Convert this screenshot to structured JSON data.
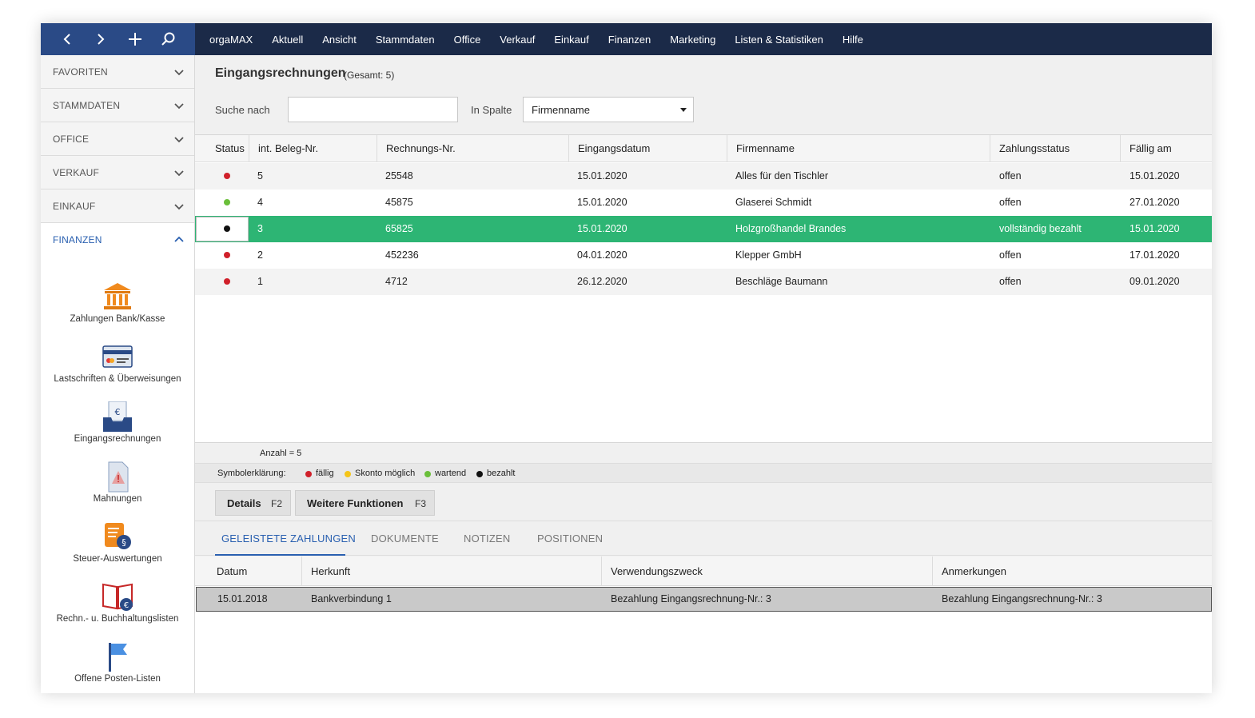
{
  "topbar": {
    "nav": {
      "back_icon": "chevron-left-icon",
      "forward_icon": "chevron-right-icon",
      "new_icon": "plus-icon",
      "search_icon": "search-icon"
    },
    "menu": [
      "orgaMAX",
      "Aktuell",
      "Ansicht",
      "Stammdaten",
      "Office",
      "Verkauf",
      "Einkauf",
      "Finanzen",
      "Marketing",
      "Listen & Statistiken",
      "Hilfe"
    ]
  },
  "sidebar": {
    "sections": [
      "FAVORITEN",
      "STAMMDATEN",
      "OFFICE",
      "VERKAUF",
      "EINKAUF",
      "FINANZEN"
    ],
    "open_section": "FINANZEN",
    "tools": [
      {
        "label": "Zahlungen Bank/Kasse",
        "icon": "bank-icon"
      },
      {
        "label": "Lastschriften & Überweisungen",
        "icon": "card-icon"
      },
      {
        "label": "Eingangsrechnungen",
        "icon": "inbox-euro-icon"
      },
      {
        "label": "Mahnungen",
        "icon": "warning-document-icon"
      },
      {
        "label": "Steuer-Auswertungen",
        "icon": "tax-scroll-icon"
      },
      {
        "label": "Rechn.- u. Buchhaltungslisten",
        "icon": "ledger-book-icon"
      },
      {
        "label": "Offene Posten-Listen",
        "icon": "flag-icon"
      }
    ]
  },
  "main": {
    "title": "Eingangsrechnungen",
    "subtitle": "(Gesamt: 5)",
    "search_label": "Suche nach",
    "search_value": "",
    "column_label": "In Spalte",
    "column_value": "Firmenname"
  },
  "grid": {
    "headers": [
      "Status",
      "int. Beleg-Nr.",
      "Rechnungs-Nr.",
      "Eingangsdatum",
      "Firmenname",
      "Zahlungsstatus",
      "Fällig am"
    ],
    "rows": [
      {
        "status": "fällig",
        "beleg": "5",
        "rechnung": "25548",
        "datum": "15.01.2020",
        "firma": "Alles für den Tischler",
        "zahlung": "offen",
        "faellig": "15.01.2020"
      },
      {
        "status": "wartend",
        "beleg": "4",
        "rechnung": "45875",
        "datum": "15.01.2020",
        "firma": "Glaserei Schmidt",
        "zahlung": "offen",
        "faellig": "27.01.2020"
      },
      {
        "status": "bezahlt",
        "beleg": "3",
        "rechnung": "65825",
        "datum": "15.01.2020",
        "firma": "Holzgroßhandel Brandes",
        "zahlung": "vollständig bezahlt",
        "faellig": "15.01.2020"
      },
      {
        "status": "fällig",
        "beleg": "2",
        "rechnung": "452236",
        "datum": "04.01.2020",
        "firma": "Klepper GmbH",
        "zahlung": "offen",
        "faellig": "17.01.2020"
      },
      {
        "status": "fällig",
        "beleg": "1",
        "rechnung": "4712",
        "datum": "26.12.2020",
        "firma": "Beschläge Baumann",
        "zahlung": "offen",
        "faellig": "09.01.2020"
      }
    ],
    "selected_row": 2,
    "count": "Anzahl = 5"
  },
  "legend": {
    "label": "Symbolerklärung:",
    "items": [
      {
        "label": "fällig",
        "color": "#d0202a"
      },
      {
        "label": "Skonto möglich",
        "color": "#f5c518"
      },
      {
        "label": "wartend",
        "color": "#6abf3a"
      },
      {
        "label": "bezahlt",
        "color": "#111111"
      }
    ]
  },
  "buttons": [
    {
      "label": "Details",
      "key": "F2"
    },
    {
      "label": "Weitere Funktionen",
      "key": "F3"
    }
  ],
  "tabs": [
    "GELEISTETE ZAHLUNGEN",
    "DOKUMENTE",
    "NOTIZEN",
    "POSITIONEN"
  ],
  "active_tab": "GELEISTETE ZAHLUNGEN",
  "payments": {
    "headers": [
      "Datum",
      "Herkunft",
      "Verwendungszweck",
      "Anmerkungen"
    ],
    "rows": [
      {
        "datum": "15.01.2018",
        "herkunft": "Bankverbindung 1",
        "zweck": "Bezahlung Eingangsrechnung-Nr.: 3",
        "anmerkung": "Bezahlung Eingangsrechnung-Nr.: 3"
      }
    ]
  },
  "colors": {
    "topbar": "#1b2a48",
    "nav_box": "#2a4a86",
    "accent": "#2a60b0",
    "selected_row": "#2db574",
    "icon_orange": "#f08a1e",
    "icon_navy": "#2a4a86"
  }
}
